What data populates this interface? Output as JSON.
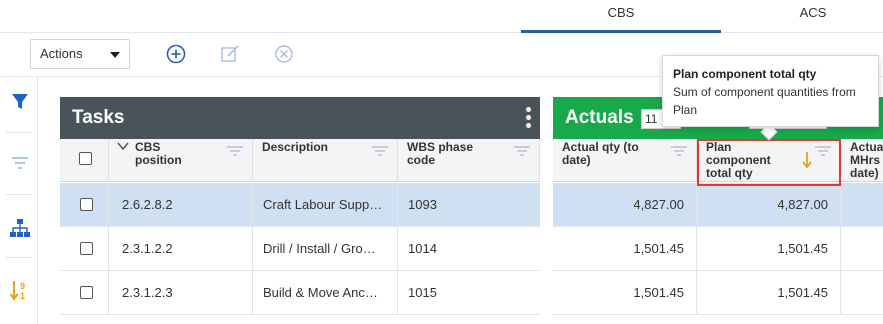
{
  "tabs": [
    {
      "label": "CBS",
      "active": true
    },
    {
      "label": "ACS",
      "active": false
    }
  ],
  "toolbar": {
    "actions_label": "Actions",
    "icons": [
      "add-circle-icon",
      "edit-icon",
      "cancel-circle-icon"
    ]
  },
  "rail": {
    "icons": [
      "filter-icon",
      "filter-lines-icon",
      "hierarchy-icon",
      "sort-numeric-icon"
    ]
  },
  "tasks": {
    "title": "Tasks",
    "columns": [
      "CBS position",
      "Description",
      "WBS phase code"
    ],
    "rows": [
      {
        "cbs": "2.6.2.8.2",
        "desc": "Craft Labour Supp…",
        "wbs": "1093",
        "selected": true
      },
      {
        "cbs": "2.3.1.2.2",
        "desc": "Drill / Install / Gro…",
        "wbs": "1014",
        "selected": false
      },
      {
        "cbs": "2.3.1.2.3",
        "desc": "Build & Move Anc…",
        "wbs": "1015",
        "selected": false
      }
    ]
  },
  "actuals": {
    "title": "Actuals",
    "input_value": "11",
    "columns": [
      "Actual qty (to date)",
      "Plan component total qty",
      "Actual MHrs date)"
    ],
    "rows": [
      {
        "actual_qty": "4,827.00",
        "plan_qty": "4,827.00"
      },
      {
        "actual_qty": "1,501.45",
        "plan_qty": "1,501.45"
      },
      {
        "actual_qty": "1,501.45",
        "plan_qty": "1,501.45"
      }
    ]
  },
  "tooltip": {
    "title": "Plan component total qty",
    "body": "Sum of component quantities from Plan"
  },
  "colors": {
    "tasks_header": "#485459",
    "actuals_header": "#18a94b",
    "selected_row": "#cfe0f3",
    "highlight": "#e03a2e",
    "accent": "#2a5fa8"
  }
}
